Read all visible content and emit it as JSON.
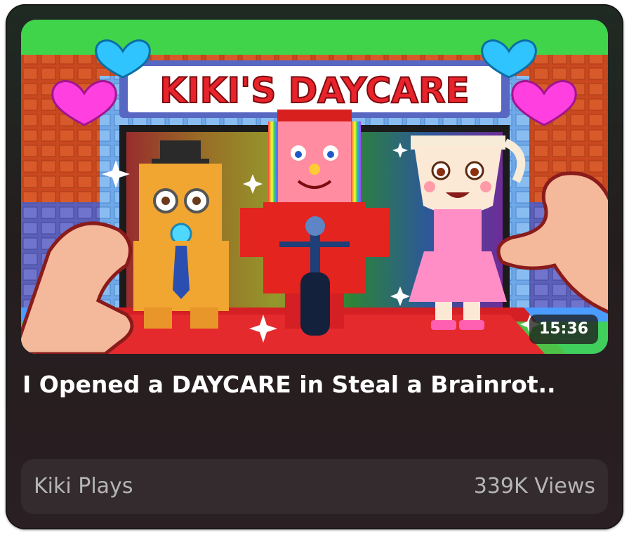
{
  "video": {
    "thumbnail_sign": "KIKI'S DAYCARE",
    "duration": "15:36",
    "title": "I Opened a DAYCARE in Steal a Brainrot..",
    "channel": "Kiki Plays",
    "views": "339K Views"
  },
  "colors": {
    "card_bg": "#241d1e",
    "footer_bg": "#332b2d",
    "title_text": "#ffffff",
    "meta_text": "#b5b5b5",
    "sign_text": "#e8232b",
    "sign_bg": "#ffffff"
  },
  "icons": [
    "heart-pink-icon",
    "heart-blue-icon",
    "sparkle-icon"
  ]
}
